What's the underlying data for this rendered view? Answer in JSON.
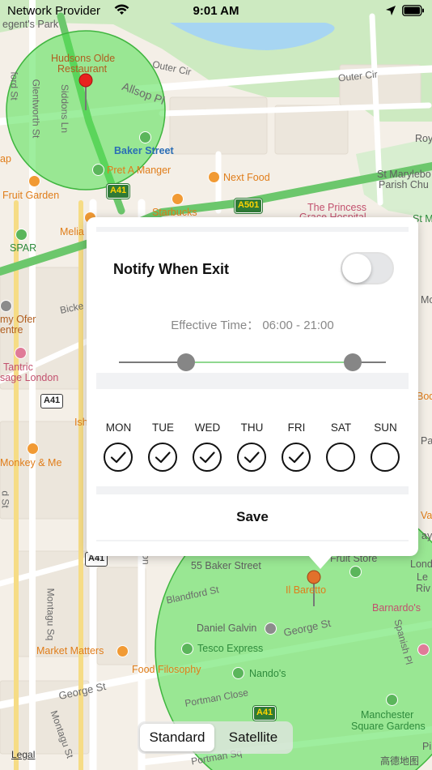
{
  "status_bar": {
    "carrier": "Network Provider",
    "time": "9:01 AM"
  },
  "map": {
    "labels": {
      "regents_park": "egent's Park",
      "hudsons_line1": "Hudsons Olde",
      "hudsons_line2": "Restaurant",
      "allsop": "Allsop Pl",
      "outer_circ_1": "Outer Cir",
      "outer_circ_2": "Outer Cir",
      "siddons": "Siddons Ln",
      "glentworth": "Glentworth St",
      "baker_street": "Baker Street",
      "pret": "Pret A Manger",
      "next_food": "Next Food",
      "fruit_garden": "Fruit Garden",
      "starbucks": "Starbucks",
      "melia": "Melia",
      "spar": "SPAR",
      "st_marylebone_1": "St Marylebo",
      "st_marylebone_2": "Parish Chu",
      "princess_grace": "The Princess",
      "grace_hosp": "Grace Hospital",
      "roy": "Roy",
      "my_ofer_1": "my Ofer",
      "my_ofer_2": "entre",
      "bicker": "Bicke",
      "tantric_1": "Tantric",
      "tantric_2": "sage London",
      "monkey": "Monkey & Me",
      "ish": "Ish",
      "market_matters": "Market Matters",
      "food_filosophy": "Food Filosophy",
      "george_st_1": "George St",
      "george_st_2": "George St",
      "montagu_sq": "Montagu Sq",
      "montagu_st": "Montagu St",
      "portman_close": "Portman Close",
      "portman_sq": "Portman Sq",
      "baker_st_55": "55 Baker Street",
      "blandford": "Blandford St",
      "il_baretto": "Il Baretto",
      "fruit_store": "Fruit Store",
      "daniel_galvin": "Daniel Galvin",
      "tesco": "Tesco Express",
      "nandos": "Nando's",
      "barnardos": "Barnardo's",
      "spanish_pl": "Spanish Pl",
      "manchester_sq_1": "Manchester",
      "manchester_sq_2": "Square Gardens",
      "lond": "Lond",
      "le": "Le",
      "riv": "Riv",
      "bod": "Bod",
      "va": "Va",
      "ay": "ay",
      "on_": "on",
      "ford_st": "ford St",
      "d_st": "d St",
      "pa": "Pa",
      "mo": "Mo",
      "pi": "Pi",
      "ap": "ap",
      "st_m": "St M"
    },
    "shields": {
      "a41_top": "A41",
      "a501": "A501",
      "a41_mid": "A41",
      "a41_low": "A41",
      "a41_bottom": "A41"
    }
  },
  "popup": {
    "notify_label": "Notify When Exit",
    "notify_enabled": false,
    "effective_time": "Effective Time： 06:00 - 21:00",
    "time_range": {
      "start_fraction": 0.25,
      "end_fraction": 0.875
    },
    "days": [
      {
        "name": "MON",
        "checked": true
      },
      {
        "name": "TUE",
        "checked": true
      },
      {
        "name": "WED",
        "checked": true
      },
      {
        "name": "THU",
        "checked": true
      },
      {
        "name": "FRI",
        "checked": true
      },
      {
        "name": "SAT",
        "checked": false
      },
      {
        "name": "SUN",
        "checked": false
      }
    ],
    "save_label": "Save"
  },
  "map_type": {
    "standard": "Standard",
    "satellite": "Satellite",
    "selected": "standard"
  },
  "legal_label": "Legal",
  "map_credit": "高德地图",
  "colors": {
    "geofence_fill": "#4fe04f",
    "slider_active": "#8fd88f",
    "slider_thumb": "#868686",
    "pin": "#e8231f",
    "pin_orange": "#e2712b"
  }
}
